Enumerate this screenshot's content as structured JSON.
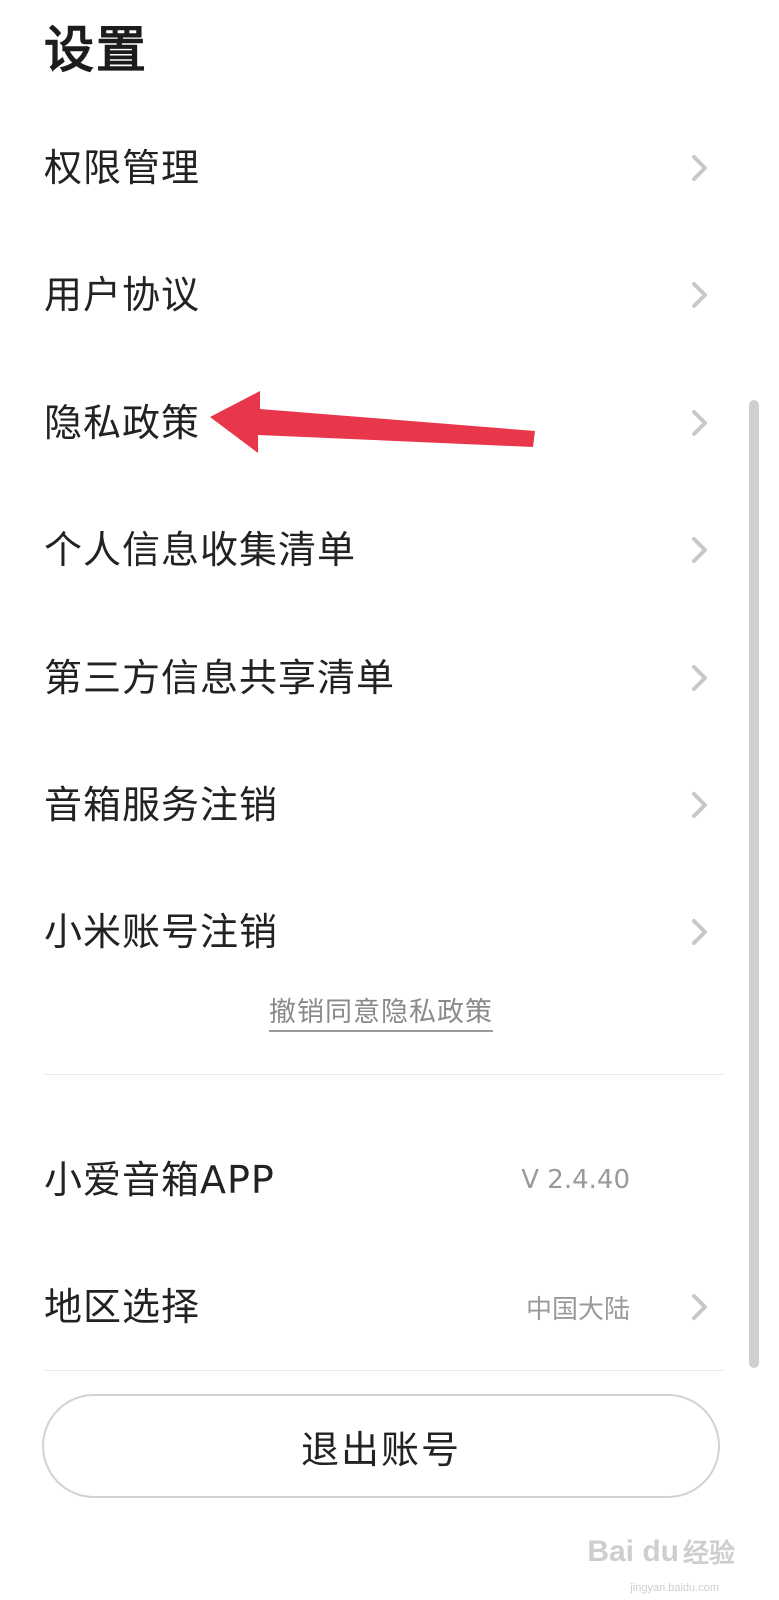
{
  "header": {
    "title": "设置"
  },
  "menu": {
    "items": [
      {
        "label": "权限管理",
        "chevron_icon": "chevron-right-icon"
      },
      {
        "label": "用户协议",
        "chevron_icon": "chevron-right-icon"
      },
      {
        "label": "隐私政策",
        "chevron_icon": "chevron-right-icon"
      },
      {
        "label": "个人信息收集清单",
        "chevron_icon": "chevron-right-icon"
      },
      {
        "label": "第三方信息共享清单",
        "chevron_icon": "chevron-right-icon"
      },
      {
        "label": "音箱服务注销",
        "chevron_icon": "chevron-right-icon"
      },
      {
        "label": "小米账号注销",
        "chevron_icon": "chevron-right-icon"
      }
    ],
    "revoke_link": "撤销同意隐私政策"
  },
  "info": {
    "app": {
      "label": "小爱音箱APP",
      "value": "V 2.4.40"
    },
    "region": {
      "label": "地区选择",
      "value": "中国大陆",
      "chevron_icon": "chevron-right-icon"
    }
  },
  "logout_button": "退出账号",
  "annotation": {
    "arrow_icon": "red-arrow-icon",
    "arrow_color": "#e8364a",
    "points_to": "隐私政策"
  },
  "watermark": {
    "logo": "Bai du",
    "text": "经验",
    "url": "jingyan.baidu.com"
  },
  "colors": {
    "text": "#222222",
    "secondary_text": "#9a9a9a",
    "chevron": "#c8c8c8",
    "button_border": "#d2d2d2",
    "scrollbar": "#cfcfcf"
  }
}
